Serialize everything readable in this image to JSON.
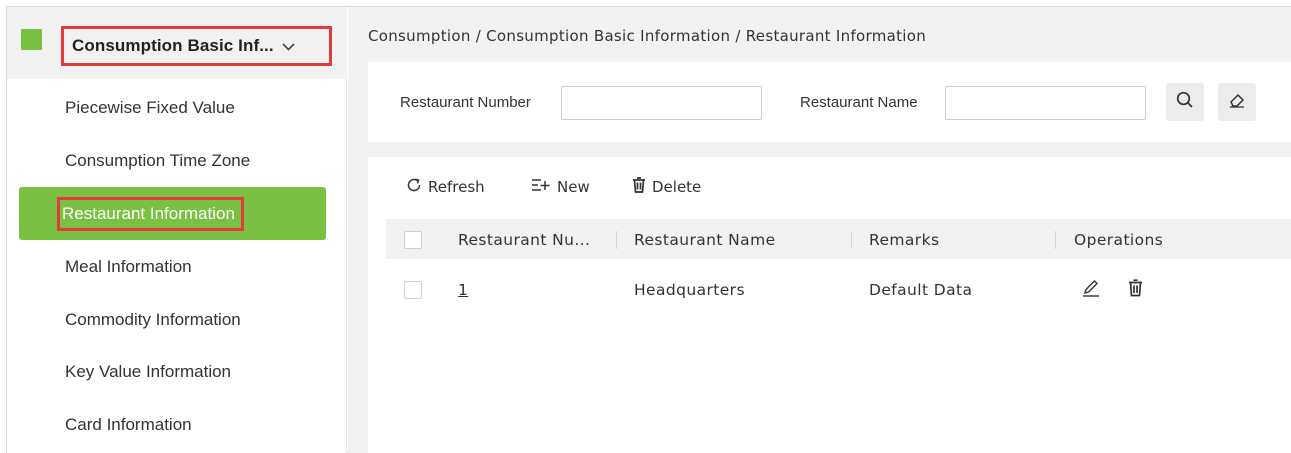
{
  "sidebar": {
    "module_label": "Consumption Basic Inf...",
    "items": [
      {
        "label": "Piecewise Fixed Value"
      },
      {
        "label": "Consumption Time Zone"
      },
      {
        "label": "Restaurant Information"
      },
      {
        "label": "Meal Information"
      },
      {
        "label": "Commodity Information"
      },
      {
        "label": "Key Value Information"
      },
      {
        "label": "Card Information"
      }
    ],
    "active_index": 2
  },
  "breadcrumb": "Consumption / Consumption Basic Information / Restaurant Information",
  "search": {
    "restaurant_number_label": "Restaurant Number",
    "restaurant_number_value": "",
    "restaurant_name_label": "Restaurant Name",
    "restaurant_name_value": ""
  },
  "toolbar": {
    "refresh": "Refresh",
    "new": "New",
    "delete": "Delete"
  },
  "table": {
    "columns": [
      "Restaurant Nu...",
      "Restaurant Name",
      "Remarks",
      "Operations"
    ],
    "rows": [
      {
        "number": "1",
        "name": "Headquarters",
        "remarks": "Default Data"
      }
    ]
  },
  "colors": {
    "accent": "#7ac143",
    "highlight": "#e23b3b"
  },
  "icons": [
    "chevron-down-icon",
    "search-icon",
    "eraser-icon",
    "refresh-icon",
    "new-icon",
    "trash-icon",
    "edit-icon"
  ]
}
